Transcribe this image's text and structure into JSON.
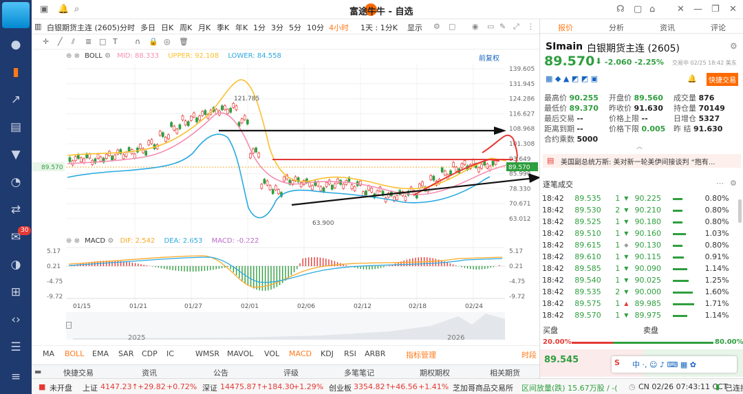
{
  "window": {
    "title": "富途牛牛 - 自选"
  },
  "sidebar": {
    "badge": "30"
  },
  "instrument_tab": "白银期货主连 (2605)",
  "toolbar": {
    "periods": [
      "分时",
      "多日",
      "日K",
      "周K",
      "月K",
      "季K",
      "年K",
      "1分",
      "3分",
      "5分",
      "10分",
      "4小时",
      "1天 : 1分K",
      "显示"
    ],
    "active_period": "4小时"
  },
  "boll": {
    "label": "BOLL",
    "mid_label": "MID:",
    "mid": "88.333",
    "upper_label": "UPPER:",
    "upper": "92.108",
    "lower_label": "LOWER:",
    "lower": "84.558",
    "adjust": "前复权"
  },
  "macd": {
    "label": "MACD",
    "dif_label": "DIF:",
    "dif": "2.542",
    "dea_label": "DEA:",
    "dea": "2.653",
    "macd_label": "MACD:",
    "macd": "-0.222"
  },
  "price_axis": [
    "139.605",
    "131.945",
    "124.286",
    "116.627",
    "108.968",
    "101.308",
    "93.649",
    "85.990",
    "78.330",
    "70.671",
    "63.012"
  ],
  "current_price_tag": "89.570",
  "macd_axis": [
    "5.17",
    "0.21",
    "-4.75",
    "-9.72"
  ],
  "annotations": {
    "high": "121.785",
    "low": "63.900"
  },
  "dates": [
    "01/15",
    "01/21",
    "01/27",
    "02/01",
    "02/06",
    "02/12",
    "02/18",
    "02/24"
  ],
  "overview_years": [
    "2025",
    "2026"
  ],
  "indicator_tabs": [
    "MA",
    "BOLL",
    "EMA",
    "SAR",
    "CDP",
    "IC",
    "WMSR",
    "MAVOL",
    "VOL",
    "MACD",
    "KDJ",
    "RSI",
    "ARBR",
    "指标管理",
    "时段"
  ],
  "func_tabs": [
    "快捷交易",
    "资讯",
    "公告",
    "评级",
    "多笔笔记",
    "期权期权",
    "相关期货"
  ],
  "status": {
    "market": "未开盘",
    "sh_label": "上证",
    "sh": "4147.23↑",
    "sh_chg": "+29.82",
    "sh_pct": "+0.72%",
    "sz_label": "深证",
    "sz": "14475.87↑",
    "sz_chg": "+184.30",
    "sz_pct": "+1.29%",
    "cy_label": "创业板",
    "cy": "3354.82↑",
    "cy_chg": "+46.56",
    "cy_pct": "+1.41%",
    "cme": "芝加哥商品交易所",
    "vol": "区间放量(跌) 15.67万股 / -(",
    "time": "CN 02/26 07:43:11 CCT",
    "conn": "已连接"
  },
  "rpanel": {
    "tabs": [
      "报价",
      "分析",
      "资讯",
      "评论"
    ],
    "symbol": "SImain",
    "name": "白银期货主连 (2605)",
    "price": "89.570",
    "change": "-2.060 -2.25%",
    "trade_time": "交易中 02/25 18:42 美东",
    "quick_trade": "快捷交易",
    "quote": [
      {
        "l": "最高价",
        "v": "90.255",
        "c": "green"
      },
      {
        "l": "开盘价",
        "v": "89.560",
        "c": "green"
      },
      {
        "l": "成交量",
        "v": "876",
        "c": ""
      },
      {
        "l": "最低价",
        "v": "89.370",
        "c": "green"
      },
      {
        "l": "昨收价",
        "v": "91.630",
        "c": ""
      },
      {
        "l": "持仓量",
        "v": "70149",
        "c": ""
      },
      {
        "l": "最后交易",
        "v": "--",
        "c": ""
      },
      {
        "l": "价格上限",
        "v": "--",
        "c": ""
      },
      {
        "l": "日增仓",
        "v": "5327",
        "c": ""
      },
      {
        "l": "距离到期",
        "v": "--",
        "c": ""
      },
      {
        "l": "价格下限",
        "v": "0.005",
        "c": "green"
      },
      {
        "l": "昨  结",
        "v": "91.630",
        "c": ""
      },
      {
        "l": "合约乘数",
        "v": "5000",
        "c": ""
      }
    ],
    "news": "美国副总统万斯: 美对新一轮美伊间接谈判 “抱有...",
    "trades_title": "逐笔成交",
    "trades": [
      {
        "t": "18:42",
        "p": "89.535",
        "q": "1",
        "d": "dn",
        "p2": "90.225",
        "pct": "0.80%"
      },
      {
        "t": "18:42",
        "p": "89.530",
        "q": "2",
        "d": "dn",
        "p2": "90.210",
        "pct": "0.80%"
      },
      {
        "t": "18:42",
        "p": "89.525",
        "q": "1",
        "d": "dn",
        "p2": "90.180",
        "pct": "0.80%"
      },
      {
        "t": "18:42",
        "p": "89.510",
        "q": "1",
        "d": "dn",
        "p2": "90.160",
        "pct": "1.03%"
      },
      {
        "t": "18:42",
        "p": "89.615",
        "q": "1",
        "d": "nt",
        "p2": "90.130",
        "pct": "0.80%"
      },
      {
        "t": "18:42",
        "p": "89.610",
        "q": "1",
        "d": "dn",
        "p2": "90.115",
        "pct": "0.91%"
      },
      {
        "t": "18:42",
        "p": "89.585",
        "q": "1",
        "d": "dn",
        "p2": "90.090",
        "pct": "1.14%"
      },
      {
        "t": "18:42",
        "p": "89.540",
        "q": "1",
        "d": "dn",
        "p2": "90.025",
        "pct": "1.25%"
      },
      {
        "t": "18:42",
        "p": "89.535",
        "q": "2",
        "d": "dn",
        "p2": "90.000",
        "pct": "1.60%"
      },
      {
        "t": "18:42",
        "p": "89.575",
        "q": "1",
        "d": "up",
        "p2": "89.985",
        "pct": "1.71%"
      },
      {
        "t": "18:42",
        "p": "89.570",
        "q": "1",
        "d": "dn",
        "p2": "89.975",
        "pct": "1.14%"
      }
    ],
    "bid_label": "买盘",
    "ask_label": "卖盘",
    "bid_pct": "20.00%",
    "ask_pct": "80.00%",
    "bid_price": "89.545"
  },
  "colors": {
    "up": "#e53935",
    "down": "#2e9e3e",
    "mid": "#f48fb1",
    "upper": "#f9c02d",
    "lower": "#29a8e0",
    "accent": "#ff7a1a"
  }
}
